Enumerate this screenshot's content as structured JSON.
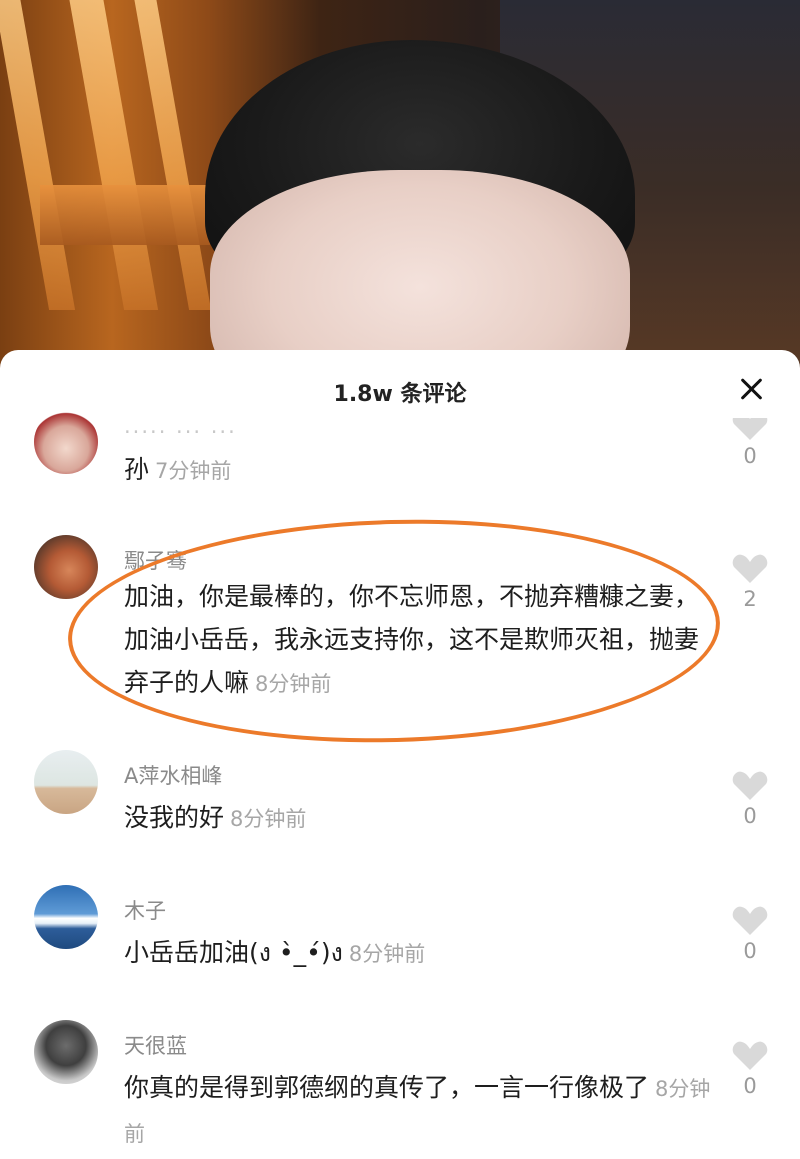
{
  "header": {
    "title": "1.8w 条评论"
  },
  "comments": [
    {
      "username": "····· ··· ···",
      "text": "孙",
      "time": "7分钟前",
      "likes": "0"
    },
    {
      "username": "鄢子骞",
      "text": "加油，你是最棒的，你不忘师恩，不抛弃糟糠之妻，加油小岳岳，我永远支持你，这不是欺师灭祖，抛妻弃子的人嘛",
      "time": "8分钟前",
      "likes": "2",
      "highlighted": true
    },
    {
      "username": "A萍水相峰",
      "text": "没我的好",
      "time": "8分钟前",
      "likes": "0"
    },
    {
      "username": "木子",
      "text": "小岳岳加油(ง •̀_•́)ง",
      "time": "8分钟前",
      "likes": "0"
    },
    {
      "username": "天很蓝",
      "text": "你真的是得到郭德纲的真传了，一言一行像极了",
      "time": "8分钟前",
      "likes": "0"
    }
  ],
  "colors": {
    "highlight": "#ec7a2a",
    "heart": "#d9d9d9"
  },
  "icons": {
    "close": "close-icon",
    "like": "heart-icon"
  }
}
